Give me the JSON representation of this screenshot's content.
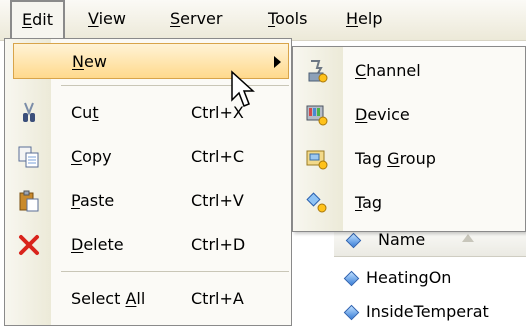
{
  "menubar": {
    "items": [
      {
        "label": "Edit",
        "u": "E",
        "rest": "dit"
      },
      {
        "label": "View",
        "u": "V",
        "rest": "iew"
      },
      {
        "label": "Server",
        "u": "S",
        "rest": "erver"
      },
      {
        "label": "Tools",
        "u": "T",
        "rest": "ools"
      },
      {
        "label": "Help",
        "u": "H",
        "rest": "elp"
      }
    ]
  },
  "edit_menu": {
    "new": {
      "label_u": "N",
      "label_rest": "ew"
    },
    "cut": {
      "pre": "Cu",
      "u": "t",
      "post": "",
      "shortcut": "Ctrl+X"
    },
    "copy": {
      "pre": "",
      "u": "C",
      "post": "opy",
      "shortcut": "Ctrl+C"
    },
    "paste": {
      "pre": "",
      "u": "P",
      "post": "aste",
      "shortcut": "Ctrl+V"
    },
    "delete": {
      "pre": "",
      "u": "D",
      "post": "elete",
      "shortcut": "Ctrl+D"
    },
    "select_all": {
      "pre": "Select ",
      "u": "A",
      "post": "ll",
      "shortcut": "Ctrl+A"
    }
  },
  "new_submenu": {
    "channel": {
      "pre": "",
      "u": "C",
      "post": "hannel"
    },
    "device": {
      "pre": "",
      "u": "D",
      "post": "evice"
    },
    "tag_group": {
      "pre": "Tag ",
      "u": "G",
      "post": "roup"
    },
    "tag": {
      "pre": "",
      "u": "T",
      "post": "ag"
    }
  },
  "list": {
    "column_header": "Name",
    "rows": [
      "HeatingOn",
      "InsideTemperat"
    ]
  },
  "colors": {
    "highlight_top": "#fff3d6",
    "highlight_bottom": "#ffd98c",
    "delete_red": "#d9241c"
  }
}
